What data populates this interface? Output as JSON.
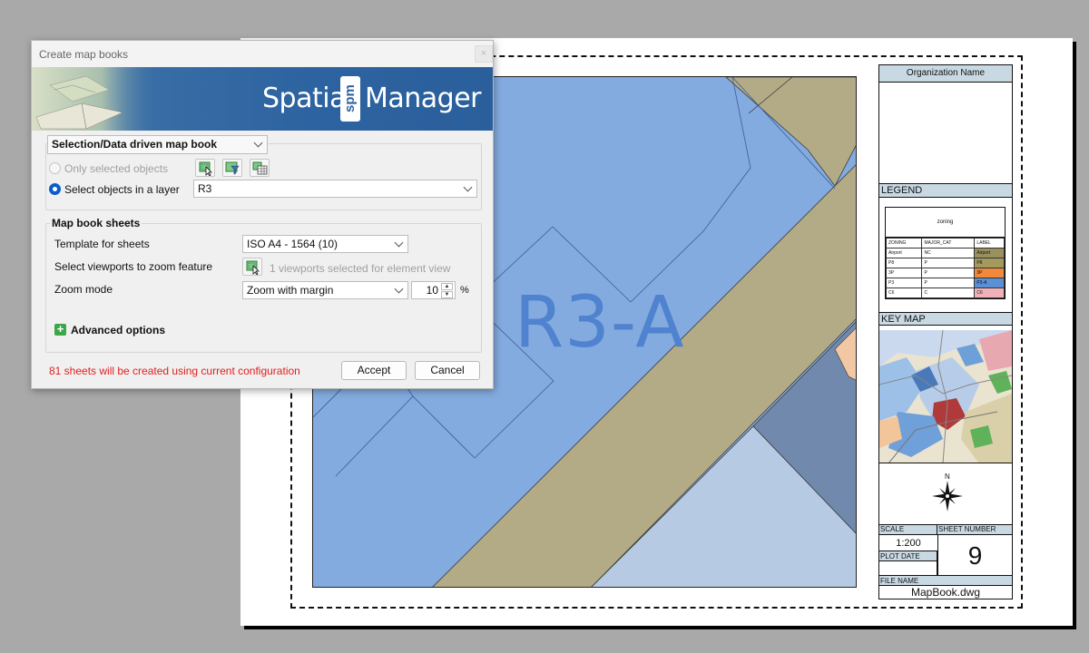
{
  "dialog": {
    "title": "Create map books",
    "close_label": "×",
    "brand": {
      "spatial": "Spatial",
      "logo": "spm",
      "manager": "Manager"
    },
    "mode_combo": "Selection/Data driven map book",
    "radio_only_selected": "Only selected objects",
    "radio_layer": "Select objects in a layer",
    "layer_value": "R3",
    "sheets_group_title": "Map book sheets",
    "template_label": "Template for sheets",
    "template_value": "ISO A4 - 1564 (10)",
    "viewports_label": "Select viewports to zoom feature",
    "viewports_status": "1 viewports selected for element view",
    "zoom_mode_label": "Zoom mode",
    "zoom_mode_value": "Zoom with margin",
    "zoom_margin_value": "10",
    "percent_sign": "%",
    "advanced_options": "Advanced options",
    "status_message": "81 sheets will be created using current configuration",
    "accept_label": "Accept",
    "cancel_label": "Cancel",
    "icons": [
      "select-objects-icon",
      "filter-objects-icon",
      "table-icon",
      "viewport-pick-icon",
      "plus-icon"
    ]
  },
  "sheet": {
    "feature_label": "R3-A",
    "title_block": {
      "organization": "Organization Name",
      "legend_title": "LEGEND",
      "legend_caption": "zoning",
      "legend_headers": [
        "ZONING",
        "MAJOR_CAT",
        "LABEL"
      ],
      "legend_rows": [
        {
          "zoning": "Airport",
          "cat": "NC",
          "label": "Airport",
          "color": "#9a9060"
        },
        {
          "zoning": "P8",
          "cat": "P",
          "label": "P8",
          "color": "#a39a5e"
        },
        {
          "zoning": "3P",
          "cat": "P",
          "label": "3P",
          "color": "#f2883a"
        },
        {
          "zoning": "P3",
          "cat": "P",
          "label": "P3-A",
          "color": "#5b8fd6"
        },
        {
          "zoning": "C6",
          "cat": "C",
          "label": "C6",
          "color": "#efb2b8"
        }
      ],
      "key_map_title": "KEY MAP",
      "north_label": "N",
      "scale_label": "SCALE",
      "scale_value": "1:200",
      "plot_date_label": "PLOT DATE",
      "sheet_number_label": "SHEET NUMBER",
      "sheet_number_value": "9",
      "file_name_label": "FILE NAME",
      "file_name_value": "MapBook.dwg"
    }
  },
  "colors": {
    "background": "#a9a9a9",
    "zone_blue": "#84abdf",
    "zone_khaki": "#b3ab86",
    "zone_slate": "#7189ad",
    "zone_light_blue": "#b6cbe3",
    "zone_peach": "#f2c8a4",
    "banner_blue": "#2d63a0",
    "status_red": "#e0201e",
    "title_block_band": "#c9d9e3"
  }
}
